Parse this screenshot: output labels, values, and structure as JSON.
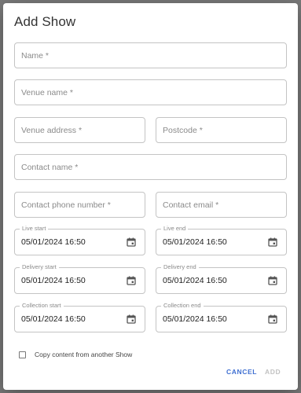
{
  "dialog": {
    "title": "Add Show",
    "fields": {
      "name": {
        "placeholder": "Name *",
        "value": ""
      },
      "venue_name": {
        "placeholder": "Venue name *",
        "value": ""
      },
      "venue_address": {
        "placeholder": "Venue address *",
        "value": ""
      },
      "postcode": {
        "placeholder": "Postcode *",
        "value": ""
      },
      "contact_name": {
        "placeholder": "Contact name *",
        "value": ""
      },
      "contact_phone": {
        "placeholder": "Contact phone number *",
        "value": ""
      },
      "contact_email": {
        "placeholder": "Contact email *",
        "value": ""
      }
    },
    "datetimes": {
      "live_start": {
        "label": "Live start",
        "value": "05/01/2024 16:50"
      },
      "live_end": {
        "label": "Live end",
        "value": "05/01/2024 16:50"
      },
      "delivery_start": {
        "label": "Delivery start",
        "value": "05/01/2024 16:50"
      },
      "delivery_end": {
        "label": "Delivery end",
        "value": "05/01/2024 16:50"
      },
      "collection_start": {
        "label": "Collection start",
        "value": "05/01/2024 16:50"
      },
      "collection_end": {
        "label": "Collection end",
        "value": "05/01/2024 16:50"
      }
    },
    "copy_checkbox": {
      "label": "Copy content from another Show",
      "checked": false
    },
    "actions": {
      "cancel": "CANCEL",
      "add": "ADD"
    },
    "colors": {
      "primary": "#3f6fd1",
      "disabled": "#c2c2c2",
      "border": "#c4c4c4"
    }
  }
}
